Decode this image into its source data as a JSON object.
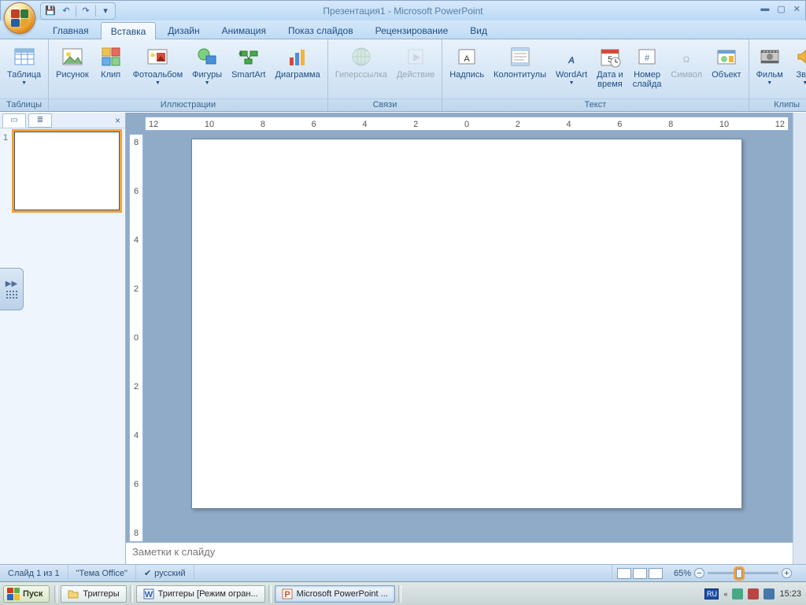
{
  "title": "Презентация1 - Microsoft PowerPoint",
  "qat": {
    "save": "💾",
    "undo": "↶",
    "redo": "↷"
  },
  "tabs": [
    "Главная",
    "Вставка",
    "Дизайн",
    "Анимация",
    "Показ слайдов",
    "Рецензирование",
    "Вид"
  ],
  "active_tab_index": 1,
  "ribbon": {
    "groups": [
      {
        "label": "Таблицы",
        "items": [
          {
            "key": "table",
            "label": "Таблица",
            "drop": true
          }
        ]
      },
      {
        "label": "Иллюстрации",
        "items": [
          {
            "key": "picture",
            "label": "Рисунок"
          },
          {
            "key": "clip",
            "label": "Клип"
          },
          {
            "key": "album",
            "label": "Фотоальбом",
            "drop": true
          },
          {
            "key": "shapes",
            "label": "Фигуры",
            "drop": true
          },
          {
            "key": "smartart",
            "label": "SmartArt"
          },
          {
            "key": "chart",
            "label": "Диаграмма"
          }
        ]
      },
      {
        "label": "Связи",
        "items": [
          {
            "key": "hyperlink",
            "label": "Гиперссылка",
            "disabled": true
          },
          {
            "key": "action",
            "label": "Действие",
            "disabled": true
          }
        ]
      },
      {
        "label": "Текст",
        "items": [
          {
            "key": "textbox",
            "label": "Надпись"
          },
          {
            "key": "headerfooter",
            "label": "Колонтитулы"
          },
          {
            "key": "wordart",
            "label": "WordArt",
            "drop": true
          },
          {
            "key": "datetime",
            "label": "Дата и\nвремя"
          },
          {
            "key": "slidenum",
            "label": "Номер\nслайда"
          },
          {
            "key": "symbol",
            "label": "Символ",
            "disabled": true
          },
          {
            "key": "object",
            "label": "Объект"
          }
        ]
      },
      {
        "label": "Клипы мультимедиа",
        "items": [
          {
            "key": "movie",
            "label": "Фильм",
            "drop": true
          },
          {
            "key": "sound",
            "label": "Звук",
            "drop": true
          }
        ]
      }
    ]
  },
  "hruler_ticks": [
    "12",
    "10",
    "8",
    "6",
    "4",
    "2",
    "0",
    "2",
    "4",
    "6",
    "8",
    "10",
    "12"
  ],
  "vruler_ticks": [
    "8",
    "6",
    "4",
    "2",
    "0",
    "2",
    "4",
    "6",
    "8"
  ],
  "thumb_number": "1",
  "notes_placeholder": "Заметки к слайду",
  "status": {
    "slide_info": "Слайд 1 из 1",
    "theme": "\"Тема Office\"",
    "lang": "русский",
    "zoom": "65%"
  },
  "taskbar": {
    "start": "Пуск",
    "items": [
      {
        "key": "folder",
        "label": "Триггеры"
      },
      {
        "key": "word",
        "label": "Триггеры [Режим огран..."
      },
      {
        "key": "ppt",
        "label": "Microsoft PowerPoint ...",
        "active": true
      }
    ],
    "lang_ind": "RU",
    "time": "15:23"
  }
}
